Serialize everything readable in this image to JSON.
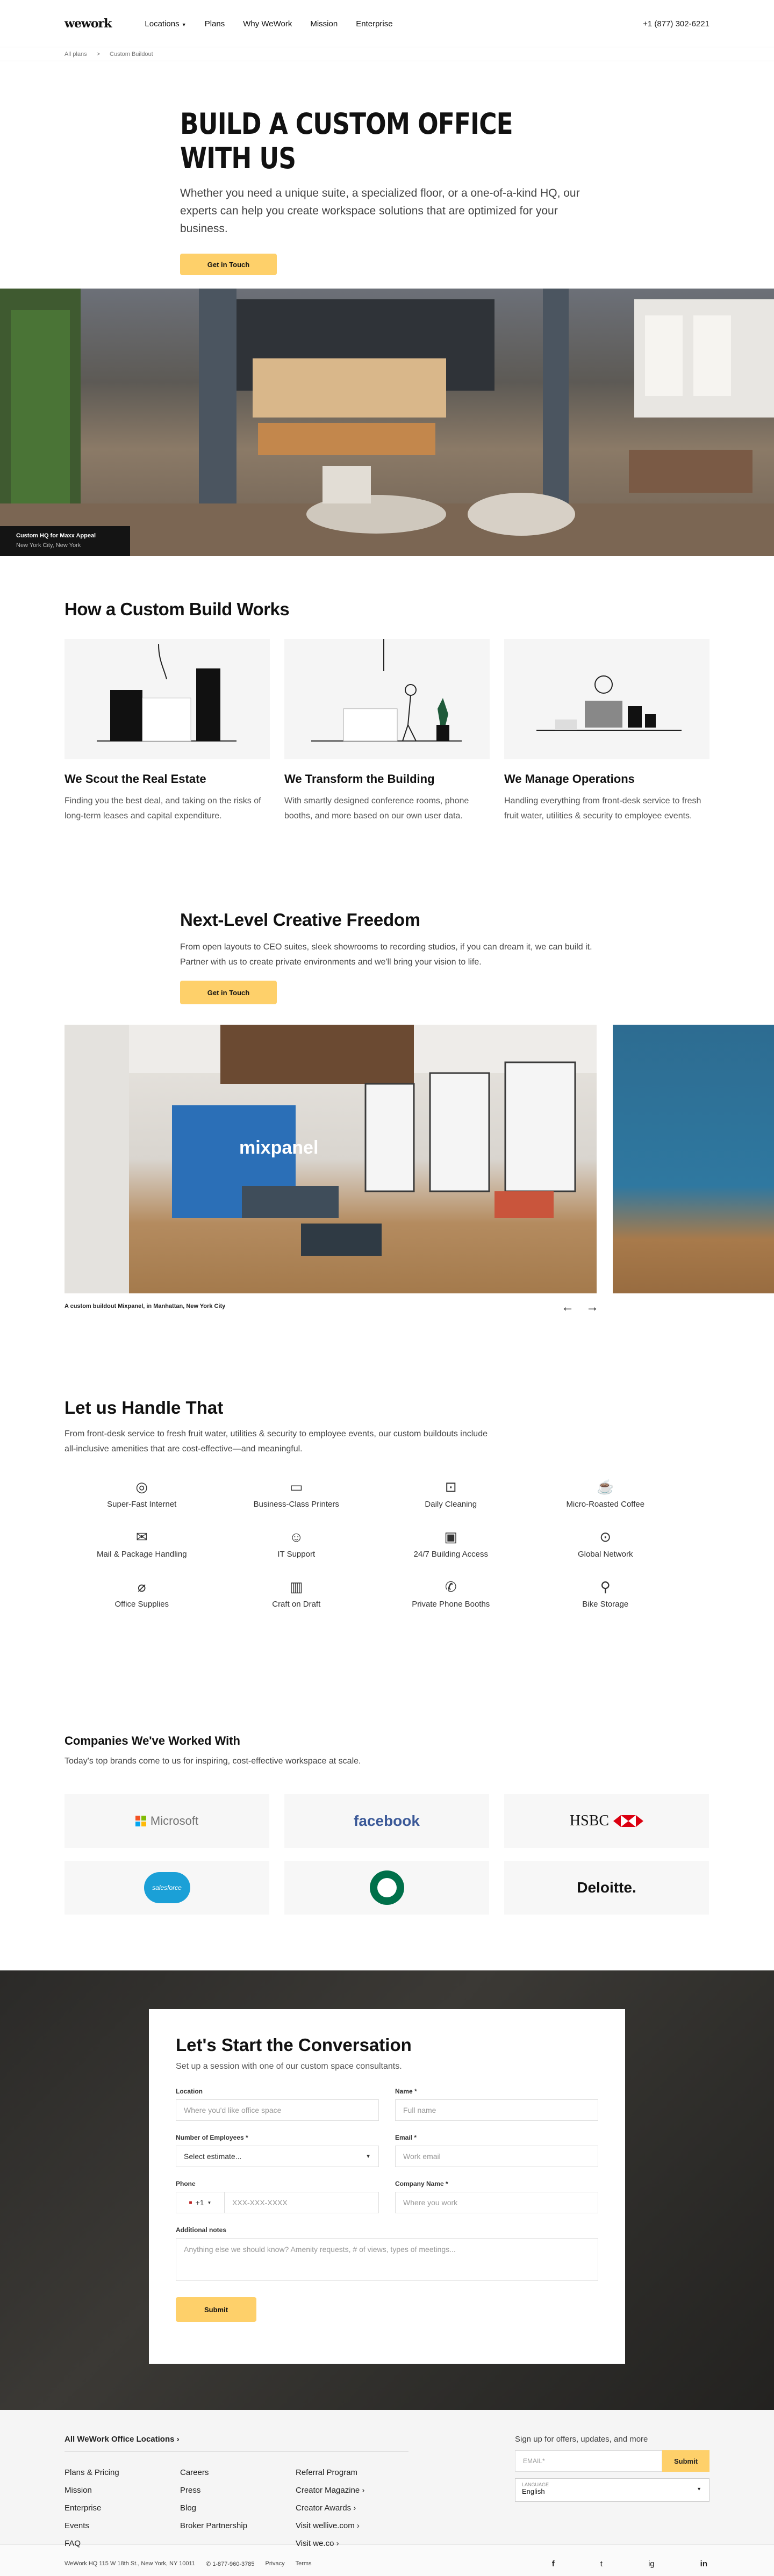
{
  "header": {
    "logo": "wework",
    "nav": [
      "Locations",
      "Plans",
      "Why WeWork",
      "Mission",
      "Enterprise"
    ],
    "phone": "+1 (877) 302-6221"
  },
  "breadcrumb": [
    "All plans",
    ">",
    "Custom Buildout"
  ],
  "hero": {
    "title": "BUILD A CUSTOM OFFICE WITH US",
    "body": "Whether you need a unique suite, a specialized floor, or a one-of-a-kind HQ, our experts can help you create workspace solutions that are optimized for your business.",
    "cta": "Get in Touch"
  },
  "hero_image": {
    "caption_title": "Custom HQ for Maxx Appeal",
    "caption_loc": "New York City, New York"
  },
  "how": {
    "title": "How a Custom Build Works",
    "cards": [
      {
        "title": "We Scout the Real Estate",
        "body": "Finding you the best deal, and taking on the risks of long-term leases and capital expenditure."
      },
      {
        "title": "We Transform the Building",
        "body": "With smartly designed conference rooms, phone booths, and more based on our own user data."
      },
      {
        "title": "We Manage Operations",
        "body": "Handling everything from front-desk service to fresh fruit water, utilities & security to employee events."
      }
    ]
  },
  "freedom": {
    "title": "Next-Level Creative Freedom",
    "body": "From open layouts to CEO suites, sleek showrooms to recording studios, if you can dream it, we can build it. Partner with us to create private environments and we'll bring your vision to life.",
    "cta": "Get in Touch",
    "gallery_caption": "A custom buildout Mixpanel, in Manhattan, New York City",
    "sign_text": "mixpanel",
    "prev": "←",
    "next": "→"
  },
  "amenities": {
    "title": "Let us Handle That",
    "body": "From front-desk service to fresh fruit water, utilities & security to employee events, our custom buildouts include all-inclusive amenities that are cost-effective—and meaningful.",
    "items": [
      {
        "label": "Super-Fast Internet",
        "icon": "globe-icon",
        "glyph": "◎"
      },
      {
        "label": "Business-Class Printers",
        "icon": "printer-icon",
        "glyph": "▭"
      },
      {
        "label": "Daily Cleaning",
        "icon": "cleaning-icon",
        "glyph": "⊡"
      },
      {
        "label": "Micro-Roasted Coffee",
        "icon": "coffee-icon",
        "glyph": "☕"
      },
      {
        "label": "Mail & Package Handling",
        "icon": "mail-icon",
        "glyph": "✉"
      },
      {
        "label": "IT Support",
        "icon": "it-support-icon",
        "glyph": "☺"
      },
      {
        "label": "24/7 Building Access",
        "icon": "calendar-icon",
        "glyph": "▣"
      },
      {
        "label": "Global Network",
        "icon": "location-icon",
        "glyph": "⊙"
      },
      {
        "label": "Office Supplies",
        "icon": "paperclip-icon",
        "glyph": "⌀"
      },
      {
        "label": "Craft on Draft",
        "icon": "beer-icon",
        "glyph": "▥"
      },
      {
        "label": "Private Phone Booths",
        "icon": "phone-icon",
        "glyph": "✆"
      },
      {
        "label": "Bike Storage",
        "icon": "bike-icon",
        "glyph": "⚲"
      }
    ]
  },
  "companies": {
    "title": "Companies We've Worked With",
    "body": "Today's top brands come to us for inspiring, cost-effective workspace at scale.",
    "logos": [
      "Microsoft",
      "facebook",
      "HSBC",
      "salesforce",
      "Starbucks",
      "Deloitte."
    ]
  },
  "conversation": {
    "title": "Let's Start the Conversation",
    "body": "Set up a session with one of our custom space consultants.",
    "fields": {
      "location": {
        "label": "Location",
        "placeholder": "Where you'd like office space"
      },
      "name": {
        "label": "Name *",
        "placeholder": "Full name"
      },
      "employees": {
        "label": "Number of Employees *",
        "value": "Select estimate..."
      },
      "email": {
        "label": "Email *",
        "placeholder": "Work email"
      },
      "phone": {
        "label": "Phone",
        "code": "+1",
        "placeholder": "XXX-XXX-XXXX"
      },
      "company": {
        "label": "Company Name *",
        "placeholder": "Where you work"
      },
      "notes": {
        "label": "Additional notes",
        "placeholder": "Anything else we should know? Amenity requests, # of views, types of meetings..."
      }
    },
    "submit": "Submit"
  },
  "footer": {
    "locations_title": "All WeWork Office Locations ›",
    "links": [
      "Plans & Pricing",
      "Careers",
      "Referral Program",
      "Mission",
      "Press",
      "Creator Magazine ›",
      "Enterprise",
      "Blog",
      "Creator Awards ›",
      "Events",
      "Broker Partnership",
      "Visit wellive.com ›",
      "FAQ",
      "",
      "Visit we.co ›"
    ],
    "signup": "Sign up for offers, updates, and more",
    "email_placeholder": "EMAIL*",
    "submit": "Submit",
    "language_label": "LANGUAGE",
    "language": "English",
    "bottom_address": "WeWork HQ 115 W 18th St., New York, NY 10011",
    "bottom_phone": "1-877-960-3785",
    "privacy": "Privacy",
    "terms": "Terms",
    "social": [
      "f",
      "t",
      "ig",
      "in"
    ]
  }
}
